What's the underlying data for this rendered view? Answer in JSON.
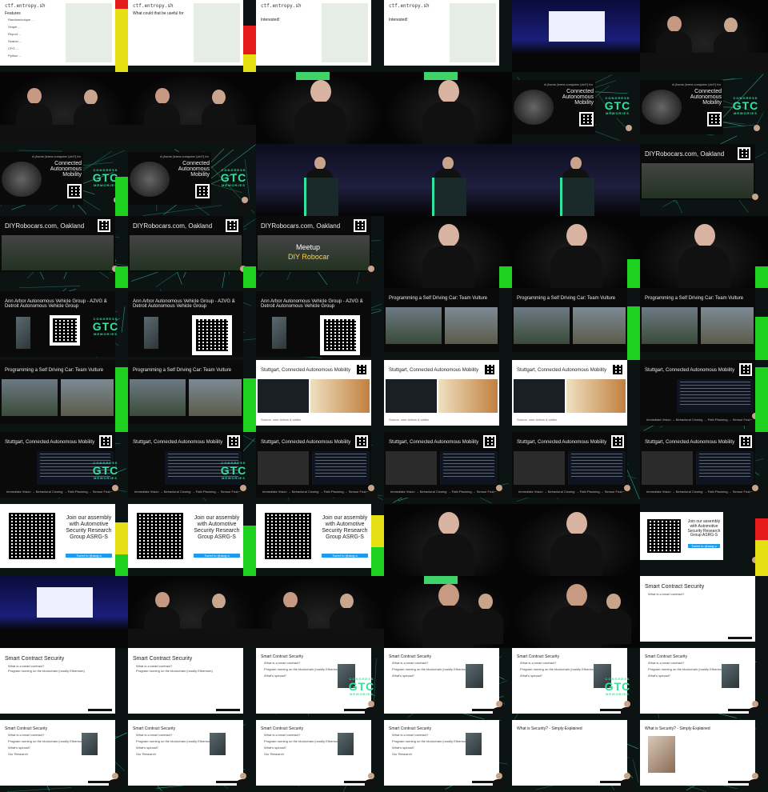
{
  "sheet": {
    "columns": 6,
    "rows": 11,
    "cell_width": 160,
    "cell_height": 90
  },
  "colors": {
    "background": "#000000",
    "accent_green": "#3fd46a",
    "meter_green": "#1fd11f",
    "meter_yellow": "#e5e014",
    "meter_red": "#e41b1b",
    "gtc_logo": "#35e1a0"
  },
  "slides": {
    "ctf_url": "ctf.entropy.sh",
    "features_title": "Features",
    "feature_lines": [
      "Random/unique ...",
      "Graph ...",
      "Report ...",
      "Search ...",
      "CFG ...",
      "Python ..."
    ],
    "ctf_question": "What could that be useful for",
    "ctf_answer": "Interested!",
    "cam_title_prefix": "A (home-)brew computer (vid?) for",
    "cam_title": "Connected Autonomous Mobility",
    "diy_title": "DIYRobocars.com, Oakland",
    "diy_meetup": "Meetup",
    "diy_robocar": "DIY Robocar",
    "a2vg_title": "Ann Arbor Autonomous Vehicle Group - A2VG & Detroit Autonomous Vehicle Group",
    "vulture_title": "Programming a Self Driving Car: Team Vulture",
    "stuttgart_title": "Stuttgart, Connected Autonomous Mobility",
    "stuttgart_caption": "Source: own videos & slides",
    "pipeline_text": "Immediate Vision → Behavioral Cloning → Path Planning → Sensor Fusion",
    "join_text": "Join our assembly with Automotive Security Research Group ASRG-S",
    "join_button": "Tweet to @asrg-s",
    "smart_title": "Smart Contract Security",
    "smart_q1": "What is a smart contract?",
    "smart_a1": "Program running on the blockchain (mostly Ethereum)",
    "smart_q2": "What's special?",
    "smart_q3": "Our Research",
    "security_title": "What is Security? - Simply Explained",
    "gtc_logo_line1": "CONGRESS",
    "gtc_logo_line2": "GTC",
    "gtc_logo_line3": "MEMORIES"
  },
  "cells": [
    {
      "row": 0,
      "col": 0,
      "kind": "ctf-features",
      "meter": [
        {
          "c": "red",
          "h": 0.12
        },
        {
          "c": "yellow",
          "h": 0.88
        }
      ]
    },
    {
      "row": 0,
      "col": 1,
      "kind": "ctf-question",
      "meter": [
        {
          "c": "red",
          "h": 0.4
        },
        {
          "c": "yellow",
          "h": 0.25
        }
      ]
    },
    {
      "row": 0,
      "col": 2,
      "kind": "ctf-answer",
      "meter": []
    },
    {
      "row": 0,
      "col": 3,
      "kind": "ctf-answer",
      "meter": []
    },
    {
      "row": 0,
      "col": 4,
      "kind": "stage-wide",
      "meter": []
    },
    {
      "row": 0,
      "col": 5,
      "kind": "panel-two",
      "meter": []
    },
    {
      "row": 1,
      "col": 0,
      "kind": "panel-two",
      "meter": []
    },
    {
      "row": 1,
      "col": 1,
      "kind": "panel-two",
      "meter": []
    },
    {
      "row": 1,
      "col": 2,
      "kind": "speaker",
      "bar": true,
      "meter": []
    },
    {
      "row": 1,
      "col": 3,
      "kind": "speaker",
      "bar": true,
      "meter": []
    },
    {
      "row": 1,
      "col": 4,
      "kind": "cam-slide",
      "logo": true,
      "meter": []
    },
    {
      "row": 1,
      "col": 5,
      "kind": "cam-slide",
      "logo": true,
      "meter": []
    },
    {
      "row": 2,
      "col": 0,
      "kind": "cam-slide-small",
      "logo": true,
      "meter": [
        {
          "c": "green",
          "h": 0.55
        }
      ]
    },
    {
      "row": 2,
      "col": 1,
      "kind": "cam-slide-small",
      "logo": true,
      "meter": []
    },
    {
      "row": 2,
      "col": 2,
      "kind": "podium",
      "meter": []
    },
    {
      "row": 2,
      "col": 3,
      "kind": "podium",
      "meter": []
    },
    {
      "row": 2,
      "col": 4,
      "kind": "podium",
      "meter": []
    },
    {
      "row": 2,
      "col": 5,
      "kind": "diy-slide-small",
      "meter": []
    },
    {
      "row": 3,
      "col": 0,
      "kind": "diy-slide",
      "meter": [
        {
          "c": "green",
          "h": 0.3
        }
      ]
    },
    {
      "row": 3,
      "col": 1,
      "kind": "diy-slide",
      "meter": [
        {
          "c": "green",
          "h": 0.3
        }
      ]
    },
    {
      "row": 3,
      "col": 2,
      "kind": "diy-meetup",
      "meter": []
    },
    {
      "row": 3,
      "col": 3,
      "kind": "speaker",
      "meter": [
        {
          "c": "green",
          "h": 0.3
        }
      ]
    },
    {
      "row": 3,
      "col": 4,
      "kind": "speaker",
      "meter": [
        {
          "c": "green",
          "h": 0.4
        }
      ]
    },
    {
      "row": 3,
      "col": 5,
      "kind": "speaker",
      "meter": [
        {
          "c": "green",
          "h": 0.3
        }
      ]
    },
    {
      "row": 4,
      "col": 0,
      "kind": "a2vg-small",
      "logo": true,
      "meter": []
    },
    {
      "row": 4,
      "col": 1,
      "kind": "a2vg",
      "meter": []
    },
    {
      "row": 4,
      "col": 2,
      "kind": "a2vg",
      "meter": []
    },
    {
      "row": 4,
      "col": 3,
      "kind": "vulture",
      "meter": []
    },
    {
      "row": 4,
      "col": 4,
      "kind": "vulture",
      "meter": [
        {
          "c": "green",
          "h": 0.75
        }
      ]
    },
    {
      "row": 4,
      "col": 5,
      "kind": "vulture",
      "meter": [
        {
          "c": "green",
          "h": 0.6
        }
      ]
    },
    {
      "row": 5,
      "col": 0,
      "kind": "vulture",
      "meter": [
        {
          "c": "green",
          "h": 0.9
        }
      ]
    },
    {
      "row": 5,
      "col": 1,
      "kind": "vulture",
      "meter": [
        {
          "c": "green",
          "h": 0.75
        }
      ]
    },
    {
      "row": 5,
      "col": 2,
      "kind": "stuttgart",
      "meter": []
    },
    {
      "row": 5,
      "col": 3,
      "kind": "stuttgart",
      "meter": []
    },
    {
      "row": 5,
      "col": 4,
      "kind": "stuttgart",
      "meter": []
    },
    {
      "row": 5,
      "col": 5,
      "kind": "stuttgart-code",
      "meter": [
        {
          "c": "green",
          "h": 0.9
        }
      ]
    },
    {
      "row": 6,
      "col": 0,
      "kind": "stuttgart-code",
      "logo": true,
      "meter": []
    },
    {
      "row": 6,
      "col": 1,
      "kind": "stuttgart-code",
      "logo": true,
      "meter": []
    },
    {
      "row": 6,
      "col": 2,
      "kind": "stuttgart-road",
      "meter": []
    },
    {
      "row": 6,
      "col": 3,
      "kind": "stuttgart-road",
      "meter": []
    },
    {
      "row": 6,
      "col": 4,
      "kind": "stuttgart-road",
      "meter": []
    },
    {
      "row": 6,
      "col": 5,
      "kind": "stuttgart-road",
      "meter": []
    },
    {
      "row": 7,
      "col": 0,
      "kind": "join",
      "meter": [
        {
          "c": "yellow",
          "h": 0.45
        },
        {
          "c": "green",
          "h": 0.3
        }
      ]
    },
    {
      "row": 7,
      "col": 1,
      "kind": "join",
      "meter": [
        {
          "c": "green",
          "h": 0.7
        }
      ]
    },
    {
      "row": 7,
      "col": 2,
      "kind": "join",
      "meter": [
        {
          "c": "yellow",
          "h": 0.45
        },
        {
          "c": "green",
          "h": 0.4
        }
      ]
    },
    {
      "row": 7,
      "col": 3,
      "kind": "speaker",
      "meter": []
    },
    {
      "row": 7,
      "col": 4,
      "kind": "speaker",
      "meter": []
    },
    {
      "row": 7,
      "col": 5,
      "kind": "join-small",
      "meter": [
        {
          "c": "red",
          "h": 0.3
        },
        {
          "c": "yellow",
          "h": 0.5
        }
      ]
    },
    {
      "row": 8,
      "col": 0,
      "kind": "stage-wide2",
      "meter": []
    },
    {
      "row": 8,
      "col": 1,
      "kind": "panel-two",
      "meter": []
    },
    {
      "row": 8,
      "col": 2,
      "kind": "panel-two",
      "meter": []
    },
    {
      "row": 8,
      "col": 3,
      "kind": "speaker2",
      "bar": true,
      "meter": []
    },
    {
      "row": 8,
      "col": 4,
      "kind": "speaker2",
      "meter": []
    },
    {
      "row": 8,
      "col": 5,
      "kind": "smart1",
      "meter": []
    },
    {
      "row": 9,
      "col": 0,
      "kind": "smart2",
      "meter": []
    },
    {
      "row": 9,
      "col": 1,
      "kind": "smart2",
      "meter": []
    },
    {
      "row": 9,
      "col": 2,
      "kind": "smart3",
      "logo": true,
      "meter": []
    },
    {
      "row": 9,
      "col": 3,
      "kind": "smart3",
      "meter": []
    },
    {
      "row": 9,
      "col": 4,
      "kind": "smart3",
      "logo": true,
      "meter": []
    },
    {
      "row": 9,
      "col": 5,
      "kind": "smart3",
      "meter": []
    },
    {
      "row": 10,
      "col": 0,
      "kind": "smart4",
      "meter": []
    },
    {
      "row": 10,
      "col": 1,
      "kind": "smart4",
      "meter": []
    },
    {
      "row": 10,
      "col": 2,
      "kind": "smart4",
      "meter": []
    },
    {
      "row": 10,
      "col": 3,
      "kind": "smart4",
      "meter": []
    },
    {
      "row": 10,
      "col": 4,
      "kind": "security",
      "meter": []
    },
    {
      "row": 10,
      "col": 5,
      "kind": "security-pic",
      "meter": []
    }
  ]
}
